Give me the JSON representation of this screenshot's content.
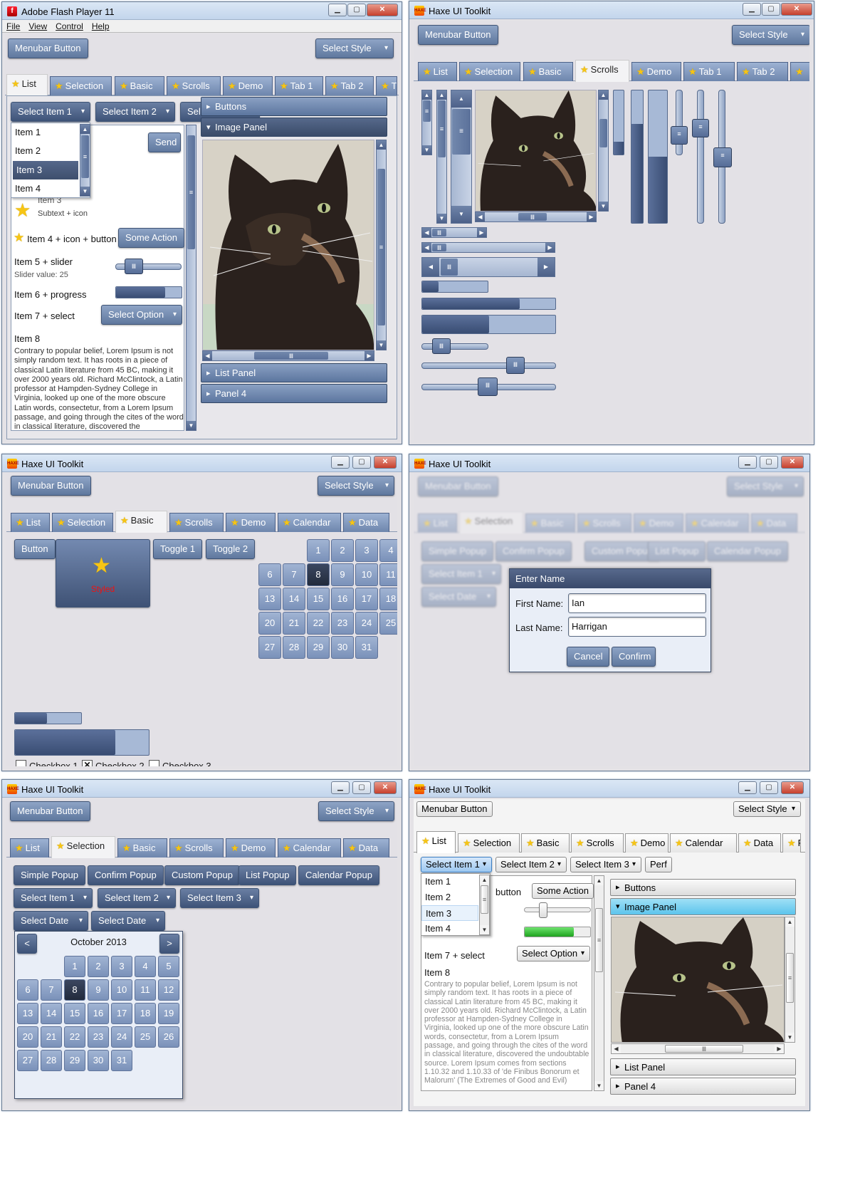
{
  "windows": {
    "w1": {
      "title": "Adobe Flash Player 11"
    },
    "w2": {
      "title": "Haxe UI Toolkit"
    },
    "w3": {
      "title": "Haxe UI Toolkit"
    },
    "w4": {
      "title": "Haxe UI Toolkit"
    },
    "w5": {
      "title": "Haxe UI Toolkit"
    },
    "w6": {
      "title": "Haxe UI Toolkit"
    }
  },
  "menu": {
    "file": "File",
    "view": "View",
    "control": "Control",
    "help": "Help"
  },
  "common": {
    "menubar_button": "Menubar Button",
    "select_style": "Select Style",
    "win_min": "▁",
    "win_max": "▢",
    "win_close": "✕",
    "flash_icon": "f",
    "haxe_icon": "HAXE"
  },
  "tabs": {
    "list": "List",
    "selection": "Selection",
    "basic": "Basic",
    "scrolls": "Scrolls",
    "demo": "Demo",
    "tab1": "Tab 1",
    "tab2": "Tab 2",
    "calendar": "Calendar",
    "data": "Data",
    "perf": "Perf",
    "trunc_t": "T",
    "trunc_f": "F"
  },
  "selects": {
    "item1": "Select Item 1",
    "item2": "Select Item 2",
    "item3": "Select Item 3",
    "option": "Select Option",
    "date": "Select Date"
  },
  "dropdown_items": [
    "Item 1",
    "Item 2",
    "Item 3",
    "Item 4"
  ],
  "list": {
    "send": "Send",
    "item3_partial": "Item 3",
    "subtext": "Subtext + icon",
    "item4": "Item 4 + icon + button",
    "some_action": "Some Action",
    "item5": "Item 5 + slider",
    "slider_value": "Slider value: 25",
    "item6": "Item 6 + progress",
    "progress": 0.75,
    "item7": "Item 7 + select",
    "item8": "Item 8",
    "button_partial": "button",
    "lorem_short": "Contrary to popular belief, Lorem Ipsum is not simply random text. It has roots in a piece of classical Latin literature from 45 BC, making it over 2000 years old. Richard McClintock, a Latin professor at Hampden-Sydney College in Virginia, looked up one of the more obscure Latin words, consectetur, from a Lorem Ipsum passage, and going through the cites of the word in classical literature, discovered the undoubtable source.",
    "lorem_long": "Contrary to popular belief, Lorem Ipsum is not simply random text. It has roots in a piece of classical Latin literature from 45 BC, making it over 2000 years old. Richard McClintock, a Latin professor at Hampden-Sydney College in Virginia, looked up one of the more obscure Latin words, consectetur, from a Lorem Ipsum passage, and going through the cites of the word in classical literature, discovered the undoubtable source. Lorem Ipsum comes from sections 1.10.32 and 1.10.33 of 'de Finibus Bonorum et Malorum' (The Extremes of Good and Evil)"
  },
  "accordion": {
    "buttons": "Buttons",
    "image_panel": "Image Panel",
    "list_panel": "List Panel",
    "panel4": "Panel 4"
  },
  "scrolls": {
    "progress_values": [
      0.25,
      0.73,
      0.5
    ],
    "vprogress_values": [
      0.2,
      0.75,
      0.5
    ],
    "grip": "Ⅲ",
    "menu_grip": "≡"
  },
  "basic": {
    "button": "Button",
    "styled": "Styled",
    "toggle1": "Toggle 1",
    "toggle2": "Toggle 2",
    "checkbox1": "Checkbox 1",
    "checkbox2": "Checkbox 2",
    "checkbox3": "Checkbox 3",
    "checkmark": "✕",
    "progress_values": [
      0.48,
      0.75
    ]
  },
  "popups": {
    "simple": "Simple Popup",
    "confirm": "Confirm Popup",
    "custom": "Custom Popup",
    "list": "List Popup",
    "calendar": "Calendar Popup"
  },
  "dialog": {
    "title": "Enter Name",
    "first_label": "First Name:",
    "first_value": "Ian",
    "last_label": "Last Name:",
    "last_value": "Harrigan",
    "cancel": "Cancel",
    "confirm": "Confirm"
  },
  "calendar": {
    "month": "October 2013",
    "prev": "<",
    "next": ">",
    "selected_day": 8,
    "days": [
      "1",
      "2",
      "3",
      "4",
      "5",
      "6",
      "7",
      "8",
      "9",
      "10",
      "11",
      "12",
      "13",
      "14",
      "15",
      "16",
      "17",
      "18",
      "19",
      "20",
      "21",
      "22",
      "23",
      "24",
      "25",
      "26",
      "27",
      "28",
      "29",
      "30",
      "31"
    ]
  },
  "colors": {
    "accent": "#5f789e",
    "dark": "#3e5378",
    "highlight": "#5cc4ec",
    "progress_green": "#2db82d"
  }
}
